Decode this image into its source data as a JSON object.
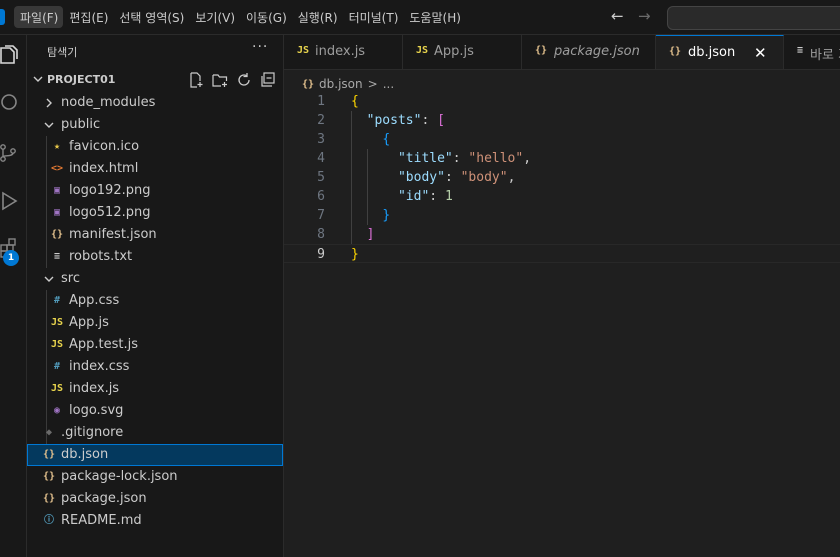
{
  "menubar": {
    "items": [
      "파일(F)",
      "편집(E)",
      "선택 영역(S)",
      "보기(V)",
      "이동(G)",
      "실행(R)",
      "터미널(T)",
      "도움말(H)"
    ],
    "active_index": 0
  },
  "nav": {
    "back_icon": "arrow-left-icon",
    "forward_icon": "arrow-right-icon"
  },
  "activity_bar": {
    "icons": [
      "explorer-icon",
      "search-icon",
      "source-control-icon",
      "run-debug-icon",
      "extensions-icon"
    ],
    "extensions_badge": "1"
  },
  "sidebar": {
    "title": "탐색기",
    "more_icon": "···",
    "project_name": "PROJECT01",
    "project_actions": [
      "new-file-icon",
      "new-folder-icon",
      "refresh-icon",
      "collapse-all-icon"
    ],
    "tree": [
      {
        "label": "node_modules",
        "type": "folder",
        "expanded": false,
        "depth": 0
      },
      {
        "label": "public",
        "type": "folder",
        "expanded": true,
        "depth": 0
      },
      {
        "label": "favicon.ico",
        "type": "star",
        "depth": 1
      },
      {
        "label": "index.html",
        "type": "html",
        "depth": 1
      },
      {
        "label": "logo192.png",
        "type": "image",
        "depth": 1
      },
      {
        "label": "logo512.png",
        "type": "image",
        "depth": 1
      },
      {
        "label": "manifest.json",
        "type": "json",
        "depth": 1
      },
      {
        "label": "robots.txt",
        "type": "text",
        "depth": 1
      },
      {
        "label": "src",
        "type": "folder",
        "expanded": true,
        "depth": 0
      },
      {
        "label": "App.css",
        "type": "css",
        "depth": 1
      },
      {
        "label": "App.js",
        "type": "js",
        "depth": 1
      },
      {
        "label": "App.test.js",
        "type": "js",
        "depth": 1
      },
      {
        "label": "index.css",
        "type": "css",
        "depth": 1
      },
      {
        "label": "index.js",
        "type": "js",
        "depth": 1
      },
      {
        "label": "logo.svg",
        "type": "svg",
        "depth": 1
      },
      {
        "label": ".gitignore",
        "type": "git",
        "depth": 0
      },
      {
        "label": "db.json",
        "type": "json",
        "depth": 0,
        "selected": true
      },
      {
        "label": "package-lock.json",
        "type": "json",
        "depth": 0
      },
      {
        "label": "package.json",
        "type": "json",
        "depth": 0
      },
      {
        "label": "README.md",
        "type": "info",
        "depth": 0
      }
    ]
  },
  "tabs": [
    {
      "label": "index.js",
      "icon": "JS",
      "italic": false,
      "active": false
    },
    {
      "label": "App.js",
      "icon": "JS",
      "italic": false,
      "active": false
    },
    {
      "label": "package.json",
      "icon": "{}",
      "italic": true,
      "active": false
    },
    {
      "label": "db.json",
      "icon": "{}",
      "italic": false,
      "active": true,
      "close": "✕"
    },
    {
      "label": "바로 가",
      "icon": "≡",
      "italic": false,
      "active": false
    }
  ],
  "breadcrumb": {
    "icon": "{}",
    "file": "db.json",
    "separator": ">",
    "rest": "..."
  },
  "code": {
    "current_line": 9,
    "lines": [
      {
        "n": "1",
        "tokens": [
          [
            "{",
            "t-brace"
          ]
        ]
      },
      {
        "n": "2",
        "tokens": [
          [
            "  ",
            "t-punc"
          ],
          [
            "\"posts\"",
            "t-key"
          ],
          [
            ": ",
            "t-punc"
          ],
          [
            "[",
            "t-bracket"
          ]
        ]
      },
      {
        "n": "3",
        "tokens": [
          [
            "    ",
            "t-punc"
          ],
          [
            "{",
            "t-brace2"
          ]
        ]
      },
      {
        "n": "4",
        "tokens": [
          [
            "      ",
            "t-punc"
          ],
          [
            "\"title\"",
            "t-key"
          ],
          [
            ": ",
            "t-punc"
          ],
          [
            "\"hello\"",
            "t-str"
          ],
          [
            ",",
            "t-punc"
          ]
        ]
      },
      {
        "n": "5",
        "tokens": [
          [
            "      ",
            "t-punc"
          ],
          [
            "\"body\"",
            "t-key"
          ],
          [
            ": ",
            "t-punc"
          ],
          [
            "\"body\"",
            "t-str"
          ],
          [
            ",",
            "t-punc"
          ]
        ]
      },
      {
        "n": "6",
        "tokens": [
          [
            "      ",
            "t-punc"
          ],
          [
            "\"id\"",
            "t-key"
          ],
          [
            ": ",
            "t-punc"
          ],
          [
            "1",
            "t-num"
          ]
        ]
      },
      {
        "n": "7",
        "tokens": [
          [
            "    ",
            "t-punc"
          ],
          [
            "}",
            "t-brace2"
          ]
        ]
      },
      {
        "n": "8",
        "tokens": [
          [
            "  ",
            "t-punc"
          ],
          [
            "]",
            "t-bracket"
          ]
        ]
      },
      {
        "n": "9",
        "tokens": [
          [
            "}",
            "t-brace"
          ]
        ]
      }
    ]
  },
  "colors": {
    "accent": "#0078d4",
    "selection_bg": "#04395e",
    "json_icon": "#e2c08d",
    "js_icon": "#e8d44d",
    "css_icon": "#519aba",
    "html_icon": "#e37933",
    "image_icon": "#a074c4"
  }
}
